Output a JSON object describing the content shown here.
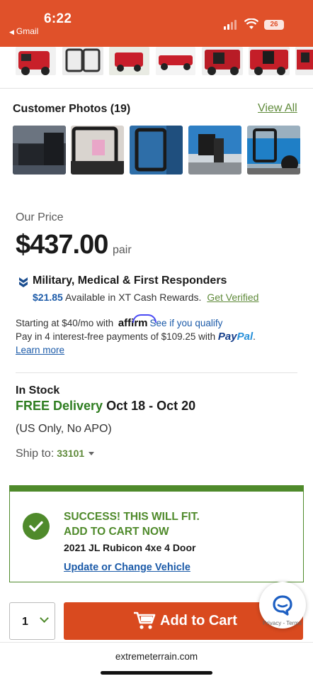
{
  "status_bar": {
    "time": "6:22",
    "back_app": "Gmail",
    "battery": "26"
  },
  "customer_photos": {
    "title": "Customer Photos (19)",
    "view_all": "View All"
  },
  "price": {
    "label": "Our Price",
    "amount": "$437.00",
    "unit": "pair"
  },
  "military": {
    "title": "Military, Medical & First Responders",
    "cash_amount": "$21.85",
    "cash_text": "Available in XT Cash Rewards.",
    "cash_link": "Get Verified"
  },
  "financing": {
    "affirm_prefix": "Starting at $40/mo with",
    "affirm_logo": "affirm",
    "affirm_link": "See if you qualify",
    "paypal_prefix": "Pay in 4 interest-free payments of $109.25 with",
    "paypal_logo_a": "Pay",
    "paypal_logo_b": "Pal",
    "paypal_suffix": ".",
    "learn_more": "Learn more"
  },
  "stock": {
    "status": "In Stock",
    "free_delivery": "FREE Delivery",
    "dates": "Oct 18 - Oct 20",
    "note": "(US Only, No APO)",
    "ship_to_label": "Ship to:",
    "zip": "33101"
  },
  "fitment": {
    "line1": "SUCCESS! THIS WILL FIT.",
    "line2": "ADD TO CART NOW",
    "vehicle": "2021 JL Rubicon 4xe 4 Door",
    "change_link": "Update or Change Vehicle"
  },
  "cart": {
    "quantity": "1",
    "button_label": "Add to Cart"
  },
  "chat": {
    "privacy": "Privacy - Terms"
  },
  "browser": {
    "url": "extremeterrain.com"
  },
  "colors": {
    "brand_orange": "#e0512a",
    "button_orange": "#d94a1f",
    "success_green": "#4f8a2b",
    "link_blue": "#1b5aa8"
  }
}
